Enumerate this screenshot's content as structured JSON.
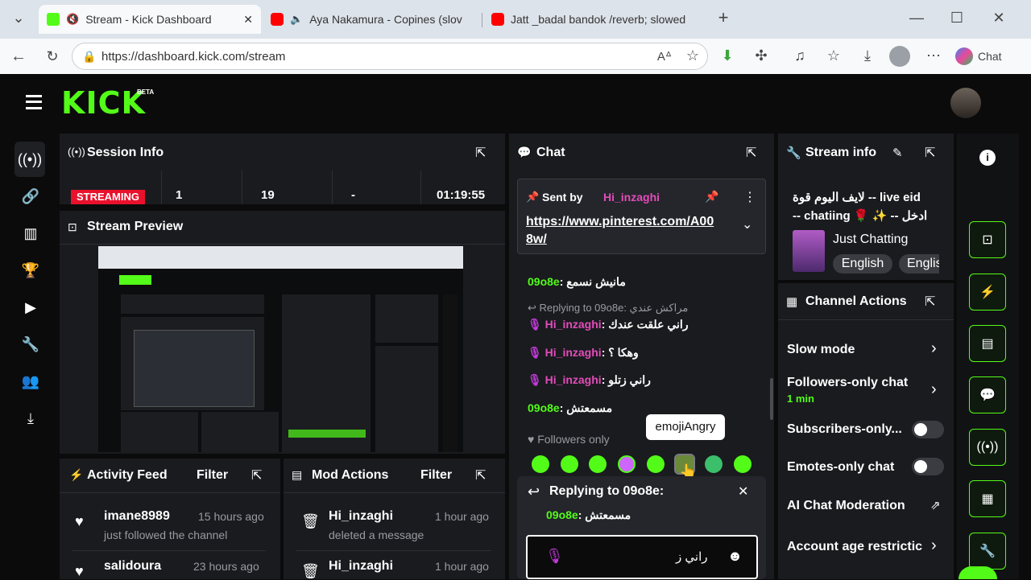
{
  "browser": {
    "tabs": [
      {
        "title": "Stream - Kick Dashboard"
      },
      {
        "title": "Aya Nakamura - Copines (slov"
      },
      {
        "title": "Jatt _badal bandok /reverb; slowed"
      }
    ],
    "url": "https://dashboard.kick.com/stream",
    "chat_label": "Chat"
  },
  "kick": {
    "logo": "KICK",
    "beta": "BETA"
  },
  "session": {
    "title": "Session Info",
    "status": "STREAMING",
    "stats": [
      "1",
      "19",
      "-",
      "01:19:55"
    ]
  },
  "preview": {
    "title": "Stream Preview"
  },
  "activity": {
    "title": "Activity Feed",
    "filter": "Filter",
    "items": [
      {
        "user": "imane8989",
        "time": "15 hours ago",
        "text": "just followed the channel"
      },
      {
        "user": "salidoura",
        "time": "23 hours ago",
        "text": ""
      }
    ]
  },
  "mod": {
    "title": "Mod Actions",
    "filter": "Filter",
    "items": [
      {
        "user": "Hi_inzaghi",
        "time": "1 hour ago",
        "text": "deleted a message"
      },
      {
        "user": "Hi_inzaghi",
        "time": "1 hour ago",
        "text": ""
      }
    ]
  },
  "chat": {
    "title": "Chat",
    "pinned": {
      "sent_by": "Sent by",
      "user": "Hi_inzaghi",
      "link": "https://www.pinterest.com/A008w/",
      "link_line1": "https://www.pinterest.com/A00",
      "link_line2": "8w/"
    },
    "messages": [
      {
        "user": "09o8e",
        "text": "مانيش نسمع"
      },
      {
        "reply": "Replying to 09o8e: مراكش عندي"
      },
      {
        "user": "Hi_inzaghi",
        "text": "راني علقت عندك"
      },
      {
        "user": "Hi_inzaghi",
        "text": "وهكا ؟"
      },
      {
        "user": "Hi_inzaghi",
        "text": "راني زتلو"
      },
      {
        "user": "09o8e",
        "text": "مسمعتش"
      }
    ],
    "followers_only": "Followers only",
    "tooltip": "emojiAngry",
    "reply_box": {
      "title": "Replying to 09o8e:",
      "user": "09o8e",
      "text": "مسمعتش"
    },
    "input_value": "راني ز"
  },
  "stream_info": {
    "title": "Stream info",
    "stream_title": "لايف اليوم قوة -- live eid -- chatiing 🌹 ✨ -- ادخل",
    "stream_title_line1": "لايف اليوم قوة -- live eid",
    "stream_title_line2": "-- chatiing 🌹 ✨ -- ادخل",
    "category": "Just Chatting",
    "tags": [
      "English",
      "English"
    ]
  },
  "channel_actions": {
    "title": "Channel Actions",
    "items": [
      {
        "label": "Slow mode",
        "control": "chevron"
      },
      {
        "label": "Followers-only chat",
        "sub": "1 min",
        "control": "chevron"
      },
      {
        "label": "Subscribers-only...",
        "control": "toggle",
        "value": false
      },
      {
        "label": "Emotes-only chat",
        "control": "toggle",
        "value": false
      },
      {
        "label": "AI Chat Moderation",
        "control": "external"
      },
      {
        "label": "Account age restrictic",
        "control": "chevron"
      }
    ]
  },
  "colors": {
    "accent": "#53fc18",
    "panel": "#191b1f",
    "bg": "#0b0b0c",
    "username": "#e34cb9",
    "streaming": "#e9112c"
  }
}
